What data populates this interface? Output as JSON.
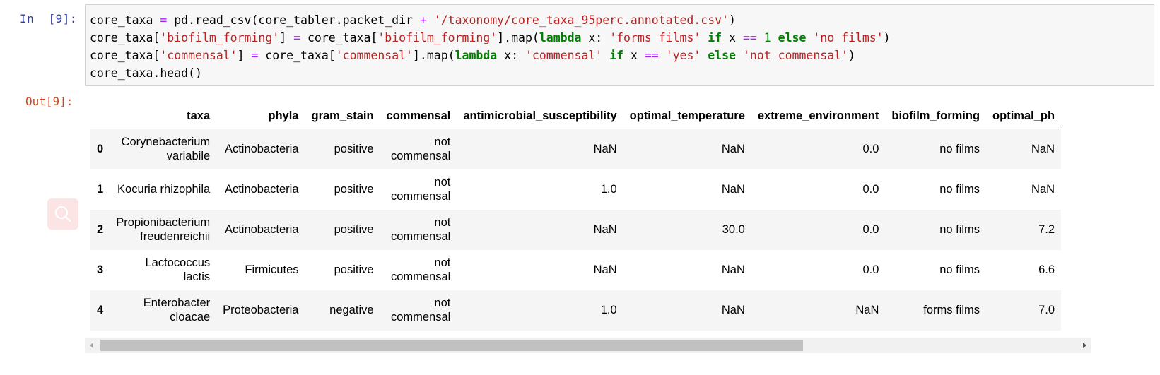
{
  "cell": {
    "in_prompt": "In  [9]:",
    "out_prompt": "Out[9]:",
    "code": {
      "line1": {
        "a": "core_taxa ",
        "eq": "=",
        "b": " pd.read_csv(core_tabler.packet_dir ",
        "plus": "+",
        "c": " ",
        "str": "'/taxonomy/core_taxa_95perc.annotated.csv'",
        "d": ")"
      },
      "line2": {
        "a": "core_taxa[",
        "s1": "'biofilm_forming'",
        "b": "] ",
        "eq": "=",
        "c": " core_taxa[",
        "s2": "'biofilm_forming'",
        "d": "].map(",
        "kw_lambda": "lambda",
        "e": " x: ",
        "s3": "'forms films'",
        "f": " ",
        "kw_if": "if",
        "g": " x ",
        "eqeq": "==",
        "h": " ",
        "num": "1",
        "i": " ",
        "kw_else": "else",
        "j": " ",
        "s4": "'no films'",
        "k": ")"
      },
      "line3": {
        "a": "core_taxa[",
        "s1": "'commensal'",
        "b": "] ",
        "eq": "=",
        "c": " core_taxa[",
        "s2": "'commensal'",
        "d": "].map(",
        "kw_lambda": "lambda",
        "e": " x: ",
        "s3": "'commensal'",
        "f": " ",
        "kw_if": "if",
        "g": " x ",
        "eqeq": "==",
        "h": " ",
        "s4": "'yes'",
        "i": " ",
        "kw_else": "else",
        "j": " ",
        "s5": "'not commensal'",
        "k": ")"
      },
      "line4": "core_taxa.head()"
    }
  },
  "table": {
    "columns": [
      "",
      "taxa",
      "phyla",
      "gram_stain",
      "commensal",
      "antimicrobial_susceptibility",
      "optimal_temperature",
      "extreme_environment",
      "biofilm_forming",
      "optimal_ph"
    ],
    "rows": [
      {
        "idx": "0",
        "taxa1": "Corynebacterium",
        "taxa2": "variabile",
        "phyla": "Actinobacteria",
        "gram": "positive",
        "comm1": "not",
        "comm2": "commensal",
        "anti": "NaN",
        "temp": "NaN",
        "extreme": "0.0",
        "biofilm": "no films",
        "ph": "NaN"
      },
      {
        "idx": "1",
        "taxa1": "Kocuria rhizophila",
        "taxa2": "",
        "phyla": "Actinobacteria",
        "gram": "positive",
        "comm1": "not",
        "comm2": "commensal",
        "anti": "1.0",
        "temp": "NaN",
        "extreme": "0.0",
        "biofilm": "no films",
        "ph": "NaN"
      },
      {
        "idx": "2",
        "taxa1": "Propionibacterium",
        "taxa2": "freudenreichii",
        "phyla": "Actinobacteria",
        "gram": "positive",
        "comm1": "not",
        "comm2": "commensal",
        "anti": "NaN",
        "temp": "30.0",
        "extreme": "0.0",
        "biofilm": "no films",
        "ph": "7.2"
      },
      {
        "idx": "3",
        "taxa1": "Lactococcus",
        "taxa2": "lactis",
        "phyla": "Firmicutes",
        "gram": "positive",
        "comm1": "not",
        "comm2": "commensal",
        "anti": "NaN",
        "temp": "NaN",
        "extreme": "0.0",
        "biofilm": "no films",
        "ph": "6.6"
      },
      {
        "idx": "4",
        "taxa1": "Enterobacter",
        "taxa2": "cloacae",
        "phyla": "Proteobacteria",
        "gram": "negative",
        "comm1": "not",
        "comm2": "commensal",
        "anti": "1.0",
        "temp": "NaN",
        "extreme": "NaN",
        "biofilm": "forms films",
        "ph": "7.0"
      }
    ]
  },
  "scrollbar": {
    "position_fraction": 0.0,
    "visible_fraction": 0.72
  },
  "icons": {
    "float_button": "search-icon",
    "scroll_left": "chevron-left-icon",
    "scroll_right": "chevron-right-icon"
  },
  "colors": {
    "in_prompt": "#303f9f",
    "out_prompt": "#d84315",
    "string": "#ba2121",
    "keyword": "#008000",
    "operator": "#aa22ff",
    "float_button_bg": "#fde4e4"
  }
}
